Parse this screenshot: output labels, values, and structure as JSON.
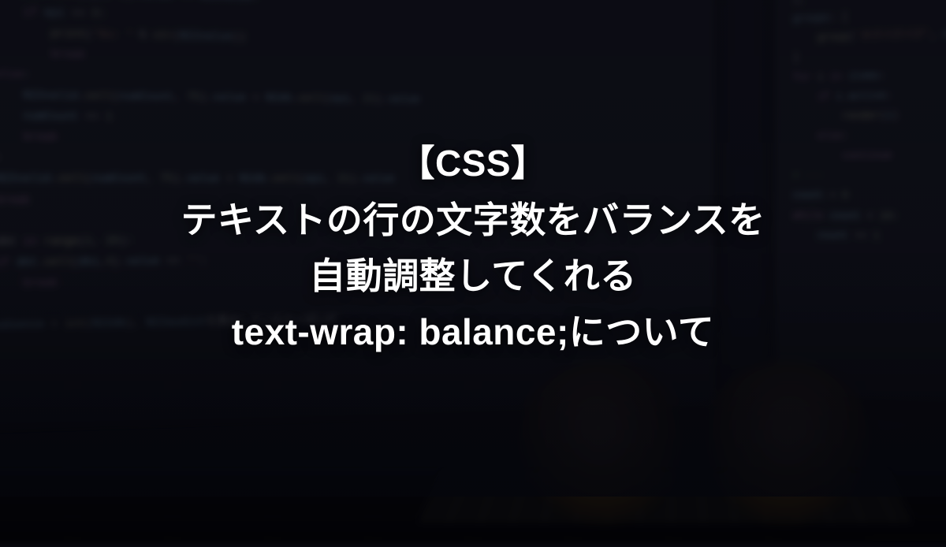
{
  "title": {
    "line1": "【CSS】",
    "line2": "テキストの行の文字数をバランスを",
    "line3": "自動調整してくれる",
    "line4": "text-wrap: balance;について"
  },
  "code_bg": {
    "left_lines": [
      {
        "indent": 2,
        "tokens": [
          [
            "kw",
            "for"
          ],
          [
            "op",
            " epi "
          ],
          [
            "kw",
            "in"
          ],
          [
            "op",
            " "
          ],
          [
            "fn",
            "range"
          ],
          [
            "op",
            "("
          ],
          [
            "num",
            "1"
          ],
          [
            "op",
            ", "
          ],
          [
            "num",
            "20"
          ],
          [
            "op",
            "):"
          ]
        ]
      },
      {
        "indent": 3,
        "tokens": [
          [
            "kw",
            "if"
          ],
          [
            "op",
            " "
          ],
          [
            "var",
            "N2db"
          ],
          [
            "op",
            "."
          ],
          [
            "fn",
            "cell"
          ],
          [
            "op",
            "("
          ],
          [
            "var",
            "epi"
          ],
          [
            "op",
            ", "
          ],
          [
            "num",
            "2"
          ],
          [
            "op",
            ")."
          ],
          [
            "var",
            "value"
          ],
          [
            "op",
            " != "
          ],
          [
            "var",
            "N22value"
          ],
          [
            "op",
            ":"
          ]
        ]
      },
      {
        "indent": 4,
        "tokens": [
          [
            "kw",
            "if"
          ],
          [
            "op",
            " "
          ],
          [
            "var",
            "epi"
          ],
          [
            "op",
            " == "
          ],
          [
            "num",
            "0"
          ],
          [
            "op",
            ":"
          ]
        ]
      },
      {
        "indent": 5,
        "tokens": [
          [
            "fn",
            "print"
          ],
          [
            "op",
            "("
          ],
          [
            "str",
            "'%s: '"
          ],
          [
            "op",
            " % "
          ],
          [
            "fn",
            "str"
          ],
          [
            "op",
            "("
          ],
          [
            "var",
            "N22value"
          ],
          [
            "op",
            "))"
          ]
        ]
      },
      {
        "indent": 5,
        "tokens": [
          [
            "kw",
            "break"
          ]
        ]
      },
      {
        "indent": 3,
        "tokens": [
          [
            "kw",
            "else"
          ],
          [
            "op",
            ":"
          ]
        ]
      },
      {
        "indent": 4,
        "tokens": [
          [
            "var",
            "N22valid"
          ],
          [
            "op",
            "."
          ],
          [
            "fn",
            "cell"
          ],
          [
            "op",
            "("
          ],
          [
            "var",
            "numCount"
          ],
          [
            "op",
            ", "
          ],
          [
            "num",
            "75"
          ],
          [
            "op",
            ")."
          ],
          [
            "var",
            "value"
          ],
          [
            "op",
            " = "
          ],
          [
            "var",
            "N2db"
          ],
          [
            "op",
            "."
          ],
          [
            "fn",
            "cell"
          ],
          [
            "op",
            "("
          ],
          [
            "var",
            "epi"
          ],
          [
            "op",
            ", "
          ],
          [
            "num",
            "21"
          ],
          [
            "op",
            ")."
          ],
          [
            "var",
            "value"
          ]
        ]
      },
      {
        "indent": 4,
        "tokens": [
          [
            "var",
            "numCount"
          ],
          [
            "op",
            " += "
          ],
          [
            "num",
            "1"
          ]
        ]
      },
      {
        "indent": 4,
        "tokens": [
          [
            "kw",
            "break"
          ]
        ]
      },
      {
        "indent": 0,
        "tokens": [
          [
            "op",
            ""
          ]
        ]
      },
      {
        "indent": 2,
        "tokens": [
          [
            "kw",
            "else"
          ],
          [
            "op",
            ":"
          ]
        ]
      },
      {
        "indent": 3,
        "tokens": [
          [
            "var",
            "N22valid"
          ],
          [
            "op",
            "."
          ],
          [
            "fn",
            "cell"
          ],
          [
            "op",
            "("
          ],
          [
            "var",
            "numCount"
          ],
          [
            "op",
            ", "
          ],
          [
            "num",
            "75"
          ],
          [
            "op",
            ")."
          ],
          [
            "var",
            "value"
          ],
          [
            "op",
            " = "
          ],
          [
            "var",
            "N2db"
          ],
          [
            "op",
            "."
          ],
          [
            "fn",
            "cell"
          ],
          [
            "op",
            "("
          ],
          [
            "var",
            "epi"
          ],
          [
            "op",
            ", "
          ],
          [
            "num",
            "21"
          ],
          [
            "op",
            ")."
          ],
          [
            "var",
            "value"
          ]
        ]
      },
      {
        "indent": 3,
        "tokens": [
          [
            "kw",
            "break"
          ]
        ]
      },
      {
        "indent": 0,
        "tokens": [
          [
            "op",
            ""
          ]
        ]
      },
      {
        "indent": 1,
        "tokens": [
          [
            "kw",
            "else"
          ],
          [
            "op",
            ":"
          ]
        ]
      },
      {
        "indent": 2,
        "tokens": [
          [
            "kw",
            "for"
          ],
          [
            "op",
            " dbt "
          ],
          [
            "kw",
            "in"
          ],
          [
            "op",
            " "
          ],
          [
            "fn",
            "range"
          ],
          [
            "op",
            "("
          ],
          [
            "num",
            "1"
          ],
          [
            "op",
            ", "
          ],
          [
            "num",
            "20"
          ],
          [
            "op",
            "):"
          ]
        ]
      },
      {
        "indent": 3,
        "tokens": [
          [
            "kw",
            "if"
          ],
          [
            "op",
            " "
          ],
          [
            "var",
            "dbt"
          ],
          [
            "op",
            "."
          ],
          [
            "fn",
            "cell"
          ],
          [
            "op",
            "("
          ],
          [
            "var",
            "dbi"
          ],
          [
            "op",
            ","
          ],
          [
            "num",
            "4"
          ],
          [
            "op",
            ")."
          ],
          [
            "var",
            "value"
          ],
          [
            "op",
            " == "
          ],
          [
            "str",
            "''"
          ],
          [
            "op",
            ":"
          ]
        ]
      },
      {
        "indent": 4,
        "tokens": [
          [
            "kw",
            "break"
          ]
        ]
      },
      {
        "indent": 0,
        "tokens": [
          [
            "op",
            ""
          ]
        ]
      },
      {
        "indent": 1,
        "tokens": [
          [
            "kw",
            "else"
          ],
          [
            "op",
            ":"
          ]
        ]
      },
      {
        "indent": 2,
        "tokens": [
          [
            "var",
            "N22audience"
          ],
          [
            "op",
            " = "
          ],
          [
            "fn",
            "int"
          ],
          [
            "op",
            "("
          ],
          [
            "var",
            "N22db"
          ],
          [
            "op",
            "), "
          ],
          [
            "var",
            "N22audiot"
          ],
          [
            "op",
            "を算出しているかっぽいが"
          ]
        ]
      }
    ],
    "right_lines": [
      {
        "indent": 0,
        "tokens": [
          [
            "op",
            "],"
          ]
        ]
      },
      {
        "indent": 0,
        "tokens": [
          [
            "var",
            "groups"
          ],
          [
            "op",
            ": ["
          ]
        ]
      },
      {
        "indent": 1,
        "tokens": [
          [
            "fn",
            "group"
          ],
          [
            "op",
            "("
          ],
          [
            "str",
            "'タグバグバグ'"
          ],
          [
            "op",
            ", "
          ],
          [
            "var",
            "children"
          ],
          [
            "op",
            ")"
          ]
        ]
      },
      {
        "indent": 0,
        "tokens": [
          [
            "op",
            "]"
          ]
        ]
      },
      {
        "indent": 0,
        "tokens": [
          [
            "op",
            ""
          ]
        ]
      },
      {
        "indent": 0,
        "tokens": [
          [
            "kw",
            "for"
          ],
          [
            "op",
            " i "
          ],
          [
            "kw",
            "in"
          ],
          [
            "op",
            " "
          ],
          [
            "var",
            "items"
          ],
          [
            "op",
            ":"
          ]
        ]
      },
      {
        "indent": 1,
        "tokens": [
          [
            "kw",
            "if"
          ],
          [
            "op",
            " "
          ],
          [
            "var",
            "i"
          ],
          [
            "op",
            "."
          ],
          [
            "var",
            "active"
          ],
          [
            "op",
            ":"
          ]
        ]
      },
      {
        "indent": 2,
        "tokens": [
          [
            "fn",
            "render"
          ],
          [
            "op",
            "("
          ],
          [
            "var",
            "i"
          ],
          [
            "op",
            ")"
          ]
        ]
      },
      {
        "indent": 1,
        "tokens": [
          [
            "kw",
            "else"
          ],
          [
            "op",
            ":"
          ]
        ]
      },
      {
        "indent": 2,
        "tokens": [
          [
            "kw",
            "continue"
          ]
        ]
      },
      {
        "indent": 0,
        "tokens": [
          [
            "op",
            ""
          ]
        ]
      },
      {
        "indent": 0,
        "tokens": [
          [
            "cm",
            "# ---"
          ]
        ]
      },
      {
        "indent": 0,
        "tokens": [
          [
            "var",
            "count"
          ],
          [
            "op",
            " = "
          ],
          [
            "num",
            "0"
          ]
        ]
      },
      {
        "indent": 0,
        "tokens": [
          [
            "kw",
            "while"
          ],
          [
            "op",
            " "
          ],
          [
            "var",
            "count"
          ],
          [
            "op",
            " < "
          ],
          [
            "num",
            "10"
          ],
          [
            "op",
            ":"
          ]
        ]
      },
      {
        "indent": 1,
        "tokens": [
          [
            "var",
            "count"
          ],
          [
            "op",
            " += "
          ],
          [
            "num",
            "1"
          ]
        ]
      }
    ]
  }
}
